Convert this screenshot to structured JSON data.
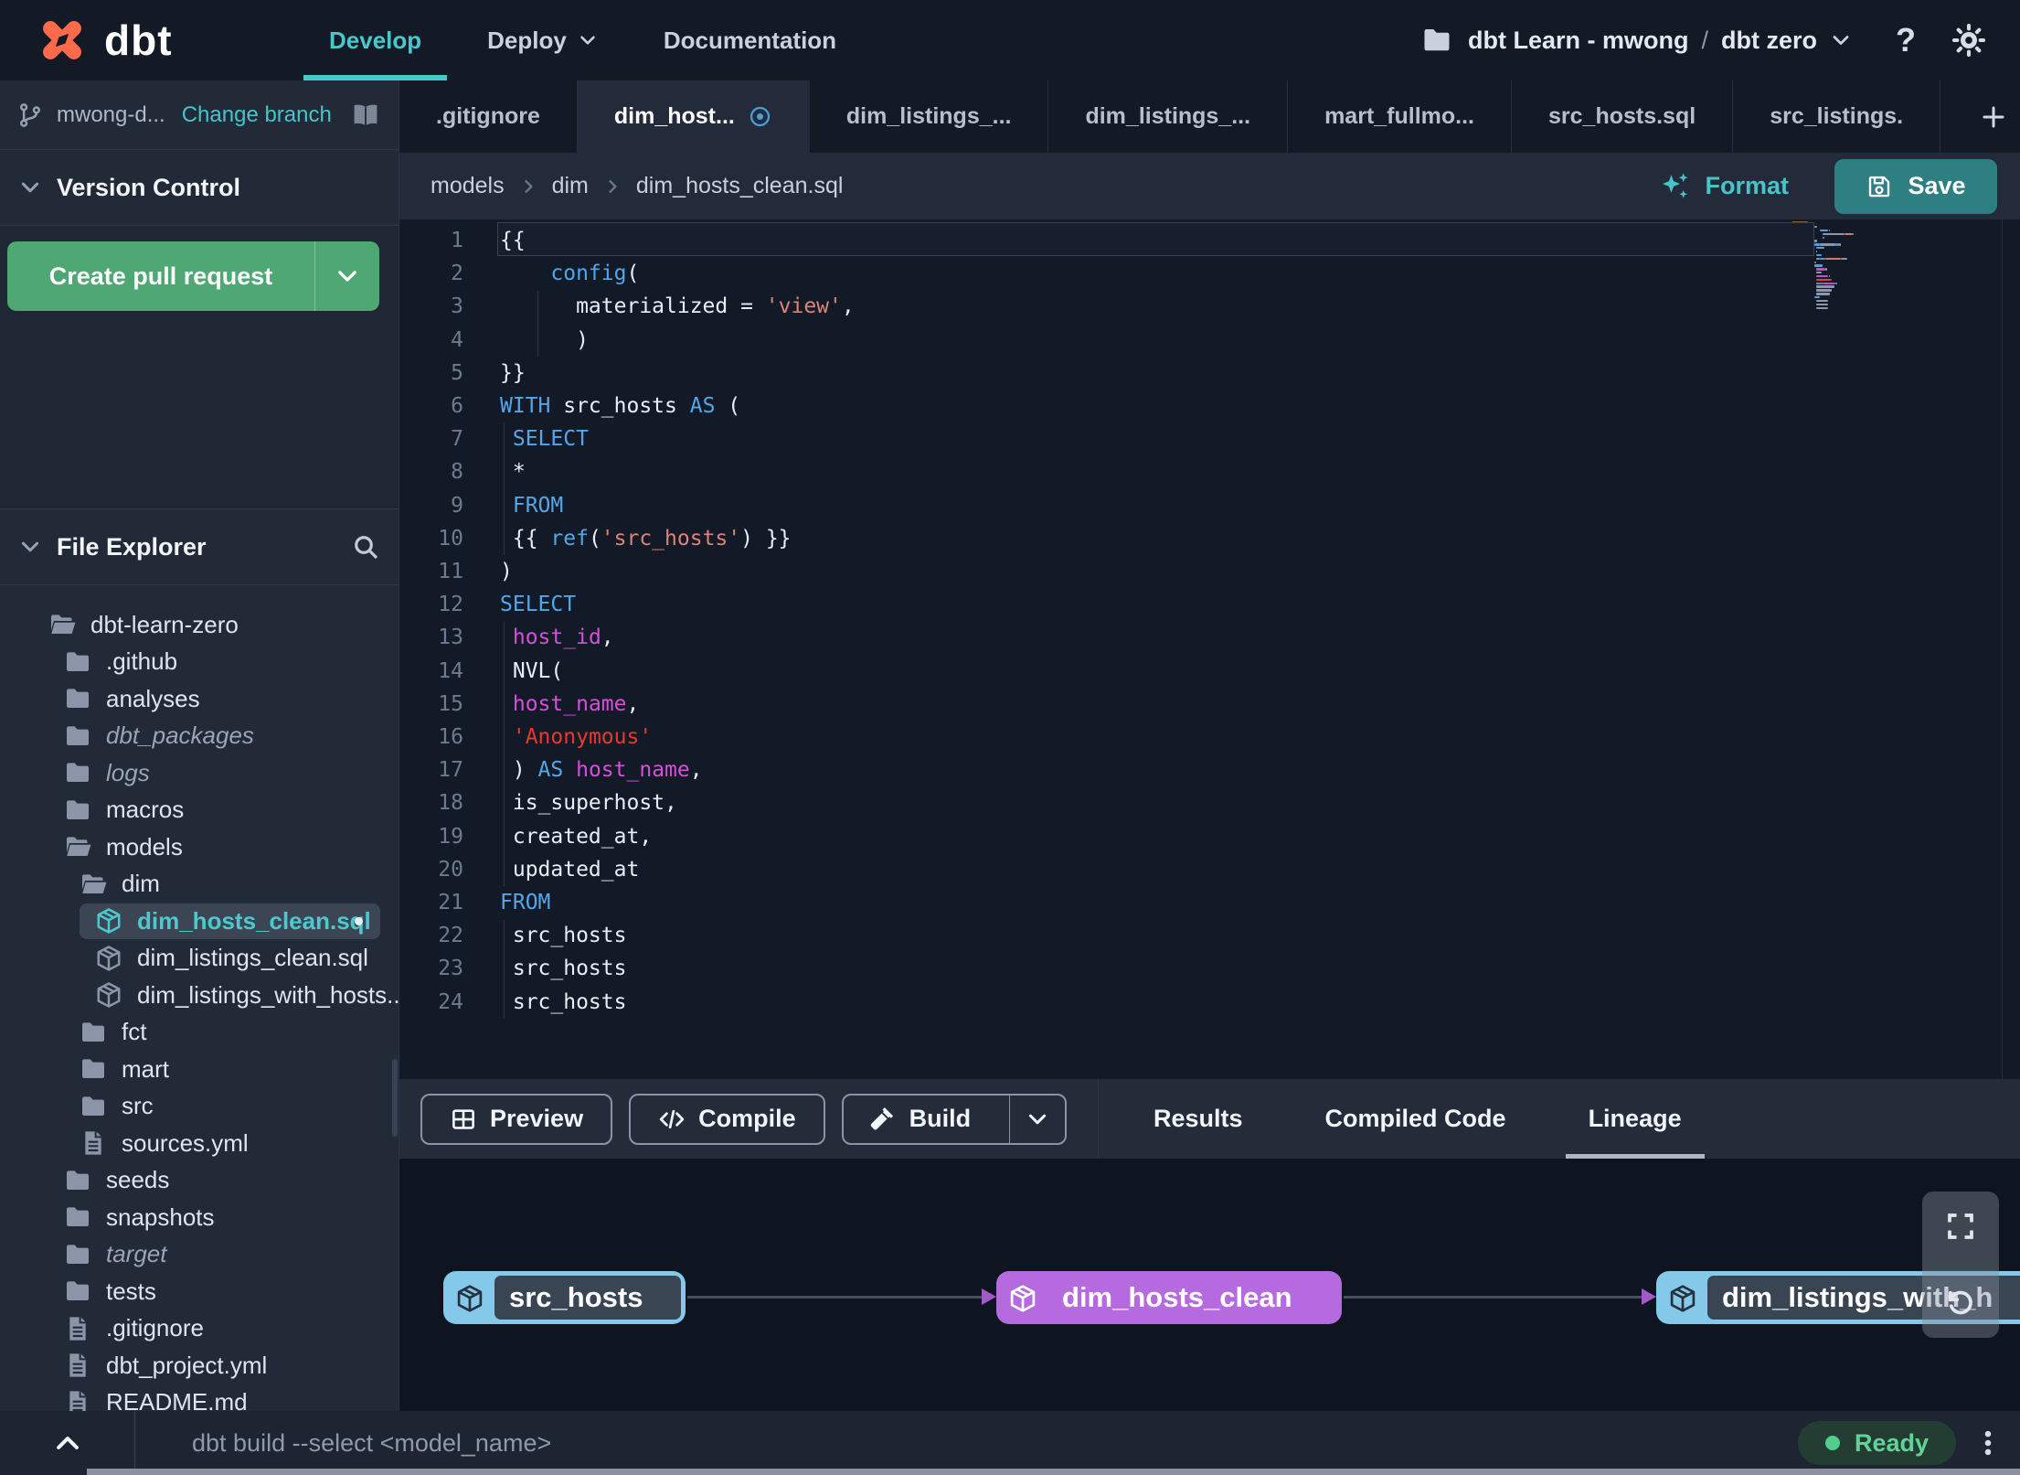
{
  "colors": {
    "accent_teal": "#46C5C9",
    "save_teal": "#2E7F82",
    "pr_green": "#4FA773",
    "logo_orange": "#FF6B4A",
    "modified_blue": "#4A9FD8",
    "node_blue": "#85C9EA",
    "node_purple": "#B56BDF",
    "ready_green": "#62D398",
    "kw_blue": "#55A6E8",
    "str_salmon": "#DD8478",
    "str_red": "#E8392E",
    "ident_magenta": "#D550D8"
  },
  "topbar": {
    "brand": "dbt",
    "nav": [
      {
        "label": "Develop",
        "active": true
      },
      {
        "label": "Deploy",
        "dropdown": true
      },
      {
        "label": "Documentation"
      }
    ],
    "account_name": "dbt Learn - mwong",
    "separator": "/",
    "project_name": "dbt zero",
    "help_label": "?"
  },
  "sidebar": {
    "branch_name": "mwong-d...",
    "change_branch_label": "Change branch",
    "version_control_title": "Version Control",
    "create_pr_label": "Create pull request",
    "file_explorer_title": "File Explorer",
    "tree": [
      {
        "label": "dbt-learn-zero",
        "icon": "folder-open",
        "indent": 0
      },
      {
        "label": ".github",
        "icon": "folder",
        "indent": 1
      },
      {
        "label": "analyses",
        "icon": "folder",
        "indent": 1
      },
      {
        "label": "dbt_packages",
        "icon": "folder",
        "indent": 1,
        "muted": true
      },
      {
        "label": "logs",
        "icon": "folder",
        "indent": 1,
        "muted": true
      },
      {
        "label": "macros",
        "icon": "folder",
        "indent": 1
      },
      {
        "label": "models",
        "icon": "folder-open",
        "indent": 1
      },
      {
        "label": "dim",
        "icon": "folder-open",
        "indent": 2
      },
      {
        "label": "dim_hosts_clean.sql",
        "icon": "model",
        "indent": 3,
        "selected": true,
        "modified": true
      },
      {
        "label": "dim_listings_clean.sql",
        "icon": "model",
        "indent": 3
      },
      {
        "label": "dim_listings_with_hosts...",
        "icon": "model",
        "indent": 3
      },
      {
        "label": "fct",
        "icon": "folder",
        "indent": 2
      },
      {
        "label": "mart",
        "icon": "folder",
        "indent": 2
      },
      {
        "label": "src",
        "icon": "folder",
        "indent": 2
      },
      {
        "label": "sources.yml",
        "icon": "file",
        "indent": 2
      },
      {
        "label": "seeds",
        "icon": "folder",
        "indent": 1
      },
      {
        "label": "snapshots",
        "icon": "folder",
        "indent": 1
      },
      {
        "label": "target",
        "icon": "folder",
        "indent": 1,
        "muted": true
      },
      {
        "label": "tests",
        "icon": "folder",
        "indent": 1
      },
      {
        "label": ".gitignore",
        "icon": "file",
        "indent": 1
      },
      {
        "label": "dbt_project.yml",
        "icon": "file",
        "indent": 1
      },
      {
        "label": "README.md",
        "icon": "file",
        "indent": 1
      }
    ]
  },
  "tabbar": {
    "tabs": [
      {
        "label": ".gitignore"
      },
      {
        "label": "dim_host...",
        "active": true,
        "modified": true
      },
      {
        "label": "dim_listings_..."
      },
      {
        "label": "dim_listings_..."
      },
      {
        "label": "mart_fullmo..."
      },
      {
        "label": "src_hosts.sql"
      },
      {
        "label": "src_listings."
      }
    ]
  },
  "editor": {
    "breadcrumb": [
      "models",
      "dim",
      "dim_hosts_clean.sql"
    ],
    "format_label": "Format",
    "save_label": "Save",
    "code_lines": [
      {
        "n": 1,
        "current": true,
        "tokens": [
          [
            "p",
            "{{"
          ]
        ]
      },
      {
        "n": 2,
        "tokens": [
          [
            "p",
            "    "
          ],
          [
            "kw",
            "config"
          ],
          [
            "p",
            "("
          ]
        ]
      },
      {
        "n": 3,
        "tokens": [
          [
            "p",
            "      materialized = "
          ],
          [
            "str",
            "'view'"
          ],
          [
            "p",
            ","
          ]
        ]
      },
      {
        "n": 4,
        "tokens": [
          [
            "p",
            "      )"
          ]
        ]
      },
      {
        "n": 5,
        "tokens": [
          [
            "p",
            "}}"
          ]
        ]
      },
      {
        "n": 6,
        "tokens": [
          [
            "kw",
            "WITH"
          ],
          [
            "p",
            " src_hosts "
          ],
          [
            "kw",
            "AS"
          ],
          [
            "p",
            " ("
          ]
        ]
      },
      {
        "n": 7,
        "tokens": [
          [
            "p",
            " "
          ],
          [
            "kw",
            "SELECT"
          ]
        ]
      },
      {
        "n": 8,
        "tokens": [
          [
            "p",
            " *"
          ]
        ]
      },
      {
        "n": 9,
        "tokens": [
          [
            "p",
            " "
          ],
          [
            "kw",
            "FROM"
          ]
        ]
      },
      {
        "n": 10,
        "tokens": [
          [
            "p",
            " {{ "
          ],
          [
            "kw",
            "ref"
          ],
          [
            "p",
            "("
          ],
          [
            "str",
            "'src_hosts'"
          ],
          [
            "p",
            ") }}"
          ]
        ]
      },
      {
        "n": 11,
        "tokens": [
          [
            "p",
            ")"
          ]
        ]
      },
      {
        "n": 12,
        "tokens": [
          [
            "kw",
            "SELECT"
          ]
        ]
      },
      {
        "n": 13,
        "tokens": [
          [
            "p",
            " "
          ],
          [
            "id",
            "host_id"
          ],
          [
            "p",
            ","
          ]
        ]
      },
      {
        "n": 14,
        "tokens": [
          [
            "p",
            " NVL("
          ]
        ]
      },
      {
        "n": 15,
        "tokens": [
          [
            "p",
            " "
          ],
          [
            "id",
            "host_name"
          ],
          [
            "p",
            ","
          ]
        ]
      },
      {
        "n": 16,
        "tokens": [
          [
            "p",
            " "
          ],
          [
            "str2",
            "'Anonymous'"
          ]
        ]
      },
      {
        "n": 17,
        "tokens": [
          [
            "p",
            " ) "
          ],
          [
            "kw",
            "AS"
          ],
          [
            "p",
            " "
          ],
          [
            "id",
            "host_name"
          ],
          [
            "p",
            ","
          ]
        ]
      },
      {
        "n": 18,
        "tokens": [
          [
            "p",
            " is_superhost,"
          ]
        ]
      },
      {
        "n": 19,
        "tokens": [
          [
            "p",
            " created_at,"
          ]
        ]
      },
      {
        "n": 20,
        "tokens": [
          [
            "p",
            " updated_at"
          ]
        ]
      },
      {
        "n": 21,
        "tokens": [
          [
            "kw",
            "FROM"
          ]
        ]
      },
      {
        "n": 22,
        "tokens": [
          [
            "p",
            " src_hosts"
          ]
        ]
      },
      {
        "n": 23,
        "tokens": [
          [
            "p",
            " src_hosts"
          ]
        ]
      },
      {
        "n": 24,
        "tokens": [
          [
            "p",
            " src_hosts"
          ]
        ]
      }
    ]
  },
  "actionbar": {
    "buttons": [
      {
        "label": "Preview",
        "icon": "grid"
      },
      {
        "label": "Compile",
        "icon": "code"
      },
      {
        "label": "Build",
        "icon": "hammer",
        "split": true
      }
    ],
    "tabs": [
      {
        "label": "Results"
      },
      {
        "label": "Compiled Code"
      },
      {
        "label": "Lineage",
        "active": true
      }
    ]
  },
  "lineage": {
    "nodes": [
      {
        "label": "src_hosts",
        "variant": "blue"
      },
      {
        "label": "dim_hosts_clean",
        "variant": "purple"
      },
      {
        "label": "dim_listings_with_h",
        "variant": "blue"
      }
    ]
  },
  "statusbar": {
    "command": "dbt build --select <model_name>",
    "ready_label": "Ready"
  }
}
